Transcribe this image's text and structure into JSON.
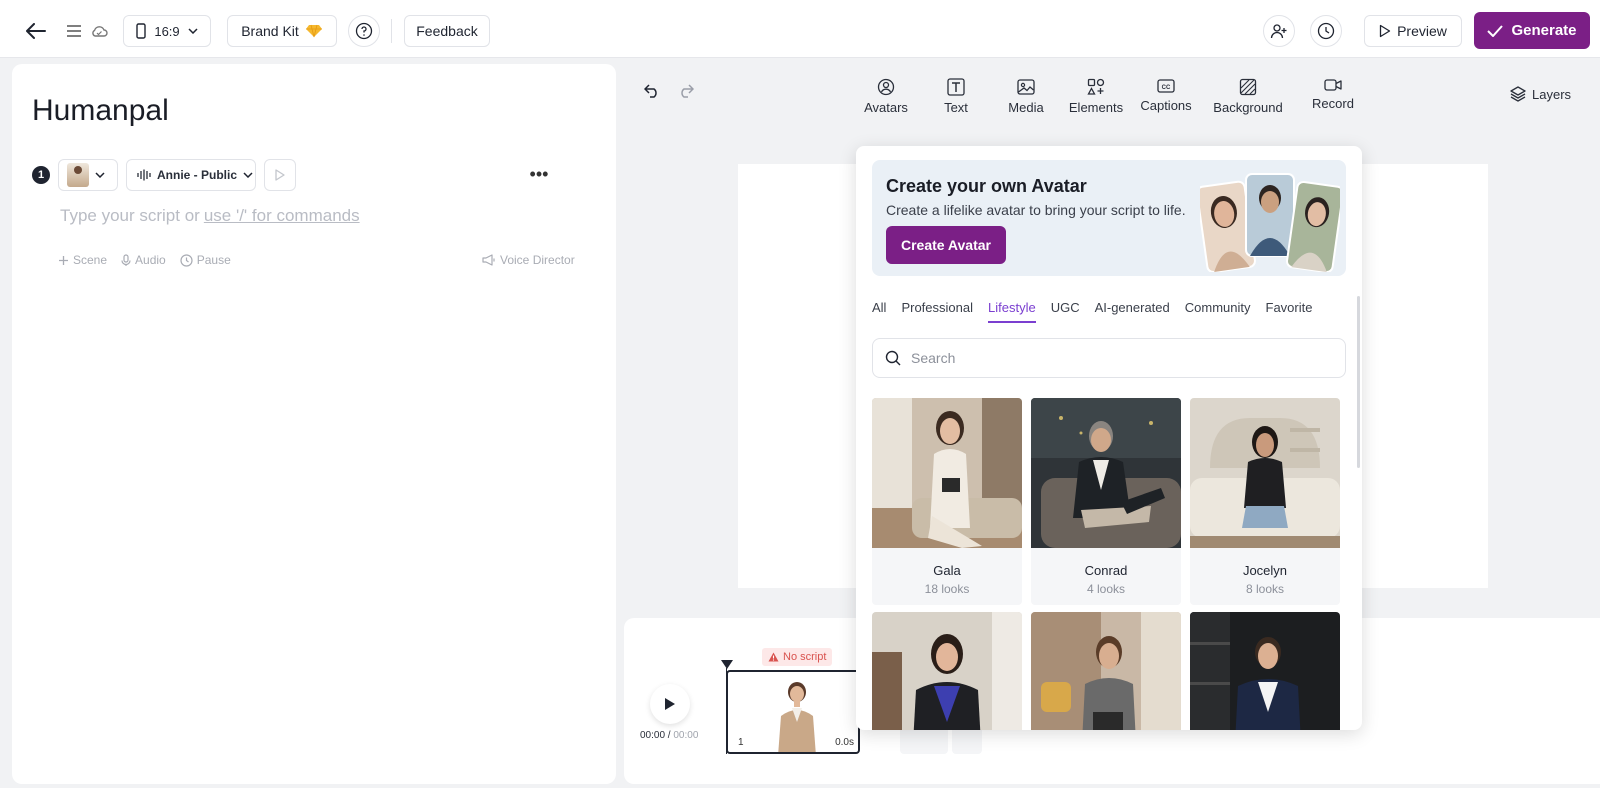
{
  "topbar": {
    "aspect_ratio": "16:9",
    "brand_kit_label": "Brand Kit",
    "feedback_label": "Feedback",
    "preview_label": "Preview",
    "generate_label": "Generate"
  },
  "script_panel": {
    "title": "Humanpal",
    "scene_number": "1",
    "voice_label": "Annie - Public",
    "placeholder_text": "Type your script or",
    "placeholder_link": "use '/' for commands",
    "actions": [
      "Scene",
      "Audio",
      "Pause"
    ],
    "voice_director_label": "Voice Director"
  },
  "toolbar": {
    "items": [
      "Avatars",
      "Text",
      "Media",
      "Elements",
      "Captions",
      "Background",
      "Record"
    ],
    "layers_label": "Layers"
  },
  "timeline": {
    "no_script_label": "No script",
    "current_time": "00:00",
    "separator": " / ",
    "total_time": "00:00",
    "clip_number": "1",
    "clip_duration": "0.0s"
  },
  "avatar_popover": {
    "banner_title": "Create your own Avatar",
    "banner_subtitle": "Create a lifelike avatar to bring your script to life.",
    "banner_button": "Create Avatar",
    "tabs": [
      "All",
      "Professional",
      "Lifestyle",
      "UGC",
      "AI-generated",
      "Community",
      "Favorite"
    ],
    "active_tab": "Lifestyle",
    "search_placeholder": "Search",
    "avatars": [
      {
        "name": "Gala",
        "looks": "18 looks"
      },
      {
        "name": "Conrad",
        "looks": "4 looks"
      },
      {
        "name": "Jocelyn",
        "looks": "8 looks"
      },
      {
        "name": "",
        "looks": ""
      },
      {
        "name": "",
        "looks": ""
      },
      {
        "name": "",
        "looks": ""
      }
    ]
  },
  "colors": {
    "brand_purple": "#7b1f86",
    "active_tab": "#7b3fd0",
    "warning": "#d9534f"
  }
}
